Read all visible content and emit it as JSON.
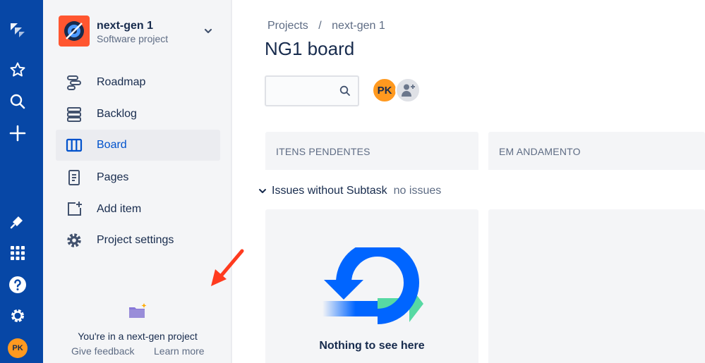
{
  "global_nav": {
    "icons": [
      "jira-logo-icon",
      "star-icon",
      "search-icon",
      "plus-icon",
      "notification-icon",
      "app-switcher-icon",
      "help-icon",
      "settings-icon"
    ],
    "user_initials": "PK"
  },
  "project": {
    "name": "next-gen 1",
    "type": "Software project"
  },
  "sidebar": {
    "items": [
      {
        "label": "Roadmap",
        "icon": "roadmap-icon"
      },
      {
        "label": "Backlog",
        "icon": "backlog-icon"
      },
      {
        "label": "Board",
        "icon": "board-icon",
        "active": true
      },
      {
        "label": "Pages",
        "icon": "pages-icon"
      },
      {
        "label": "Add item",
        "icon": "add-item-icon"
      },
      {
        "label": "Project settings",
        "icon": "gear-icon"
      }
    ],
    "nextgen_text": "You're in a next-gen project",
    "give_feedback": "Give feedback",
    "learn_more": "Learn more"
  },
  "breadcrumb": {
    "projects": "Projects",
    "separator": "/",
    "project": "next-gen 1"
  },
  "board": {
    "title": "NG1 board",
    "search_placeholder": "",
    "assignee_initials": "PK",
    "columns": [
      "ITENS PENDENTES",
      "EM ANDAMENTO"
    ],
    "swimlane_label": "Issues without Subtask",
    "swimlane_count": "no issues",
    "empty_text": "Nothing to see here"
  },
  "colors": {
    "nav_blue": "#0747a6",
    "accent": "#0052cc",
    "orange": "#ff991f",
    "logo_red": "#ff5630",
    "arrow_red": "#ff3b1f"
  }
}
